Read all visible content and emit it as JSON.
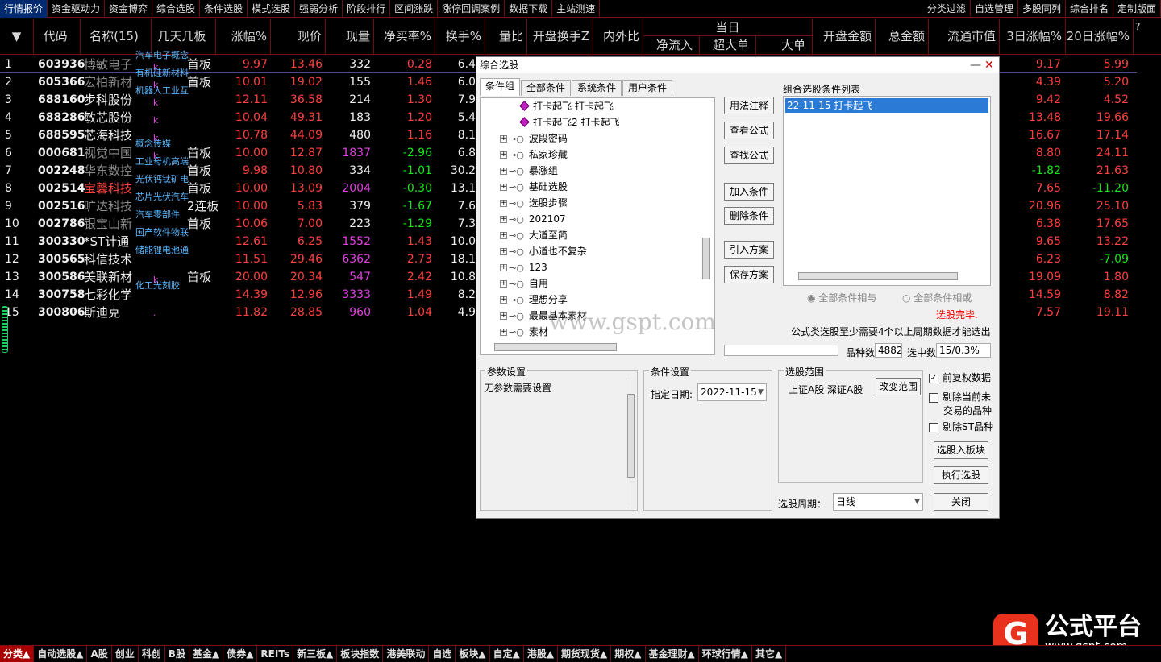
{
  "top_menu": {
    "left": [
      "行情报价",
      "资金驱动力",
      "资金博弈",
      "综合选股",
      "条件选股",
      "模式选股",
      "强弱分析",
      "阶段排行",
      "区间涨跌",
      "涨停回调案例",
      "数据下载",
      "主站测速"
    ],
    "right": [
      "分类过滤",
      "自选管理",
      "多股同列",
      "综合排名",
      "定制版面"
    ]
  },
  "header": {
    "code": "代码",
    "name": "名称(15)",
    "days": "几天几板",
    "pct": "涨幅%",
    "price": "现价",
    "vol": "现量",
    "netbuy": "净买率%",
    "turnover": "换手%",
    "ratio": "量比",
    "open_turnover": "开盘换手Z",
    "inout": "内外比",
    "today": "当日",
    "inflow": "净流入",
    "super": "超大单",
    "big": "大单",
    "open_amount": "开盘金额",
    "total_amount": "总金额",
    "mcap": "流通市值",
    "d3": "3日涨幅%",
    "d20": "20日涨幅%",
    "q": "?"
  },
  "rows": [
    {
      "idx": "1",
      "code": "603936",
      "name": "博敏电子",
      "name_color": "gry",
      "tag": "汽车电子概念",
      "k": "k",
      "days": "首板",
      "pct": "9.97",
      "price": "13.46",
      "vol": "332",
      "vol_color": "wht",
      "netbuy": "0.28",
      "nb_color": "red",
      "turn": "6.4",
      "d3": "9.17",
      "d3c": "red",
      "d20": "5.99",
      "d20c": "red"
    },
    {
      "idx": "2",
      "code": "605366",
      "name": "宏柏新材",
      "name_color": "gry",
      "tag": "有机硅新材料",
      "k": "k",
      "days": "首板",
      "pct": "10.01",
      "price": "19.02",
      "vol": "155",
      "vol_color": "wht",
      "netbuy": "1.46",
      "nb_color": "red",
      "turn": "6.0",
      "d3": "4.39",
      "d3c": "red",
      "d20": "5.20",
      "d20c": "red"
    },
    {
      "idx": "3",
      "code": "688160",
      "name": "步科股份",
      "name_color": "wht",
      "tag": "机器人工业互",
      "k": "k",
      "days": "",
      "pct": "12.11",
      "price": "36.58",
      "vol": "214",
      "vol_color": "wht",
      "netbuy": "1.30",
      "nb_color": "red",
      "turn": "7.9",
      "d3": "9.42",
      "d3c": "red",
      "d20": "4.52",
      "d20c": "red"
    },
    {
      "idx": "4",
      "code": "688286",
      "name": "敏芯股份",
      "name_color": "wht",
      "tag": "",
      "k": "k",
      "days": "",
      "pct": "10.04",
      "price": "49.31",
      "vol": "183",
      "vol_color": "wht",
      "netbuy": "1.20",
      "nb_color": "red",
      "turn": "5.4",
      "d3": "13.48",
      "d3c": "red",
      "d20": "19.66",
      "d20c": "red"
    },
    {
      "idx": "5",
      "code": "688595",
      "name": "芯海科技",
      "name_color": "wht",
      "tag": "",
      "k": "k",
      "days": "",
      "pct": "10.78",
      "price": "44.09",
      "vol": "480",
      "vol_color": "wht",
      "netbuy": "1.16",
      "nb_color": "red",
      "turn": "8.1",
      "d3": "16.67",
      "d3c": "red",
      "d20": "17.14",
      "d20c": "red"
    },
    {
      "idx": "6",
      "code": "000681",
      "name": "视觉中国",
      "name_color": "gry",
      "tag": "概念传媒",
      "k": "k",
      "days": "首板",
      "pct": "10.00",
      "price": "12.87",
      "vol": "1837",
      "vol_color": "mag",
      "netbuy": "-2.96",
      "nb_color": "grn",
      "turn": "6.8",
      "d3": "8.80",
      "d3c": "red",
      "d20": "24.11",
      "d20c": "red"
    },
    {
      "idx": "7",
      "code": "002248",
      "name": "华东数控",
      "name_color": "gry",
      "tag": "工业母机高端",
      "k": "",
      "days": "首板",
      "pct": "9.98",
      "price": "10.80",
      "vol": "334",
      "vol_color": "wht",
      "netbuy": "-1.01",
      "nb_color": "grn",
      "turn": "30.2",
      "d3": "-1.82",
      "d3c": "grn",
      "d20": "21.63",
      "d20c": "red"
    },
    {
      "idx": "8",
      "code": "002514",
      "name": "宝馨科技",
      "name_color": "red",
      "tag": "光伏钙钛矿电",
      "k": "",
      "days": "首板",
      "pct": "10.00",
      "price": "13.09",
      "vol": "2004",
      "vol_color": "mag",
      "netbuy": "-0.30",
      "nb_color": "grn",
      "turn": "13.1",
      "d3": "7.65",
      "d3c": "red",
      "d20": "-11.20",
      "d20c": "grn"
    },
    {
      "idx": "9",
      "code": "002516",
      "name": "旷达科技",
      "name_color": "gry",
      "tag": "芯片光伏汽车",
      "k": "",
      "days": "2连板",
      "pct": "10.00",
      "price": "5.83",
      "vol": "379",
      "vol_color": "wht",
      "netbuy": "-1.67",
      "nb_color": "grn",
      "turn": "7.6",
      "d3": "20.96",
      "d3c": "red",
      "d20": "25.10",
      "d20c": "red"
    },
    {
      "idx": "10",
      "code": "002786",
      "name": "银宝山新",
      "name_color": "gry",
      "tag": "汽车零部件",
      "k": "",
      "days": "首板",
      "pct": "10.06",
      "price": "7.00",
      "vol": "223",
      "vol_color": "wht",
      "netbuy": "-1.29",
      "nb_color": "grn",
      "turn": "7.3",
      "d3": "6.38",
      "d3c": "red",
      "d20": "17.65",
      "d20c": "red"
    },
    {
      "idx": "11",
      "code": "300330",
      "name": "*ST计通",
      "name_color": "wht",
      "tag": "国产软件物联",
      "k": "",
      "days": "",
      "pct": "12.61",
      "price": "6.25",
      "vol": "1552",
      "vol_color": "mag",
      "netbuy": "1.43",
      "nb_color": "red",
      "turn": "10.0",
      "d3": "9.65",
      "d3c": "red",
      "d20": "13.22",
      "d20c": "red"
    },
    {
      "idx": "12",
      "code": "300565",
      "name": "科信技术",
      "name_color": "wht",
      "tag": "储能锂电池通",
      "k": "",
      "days": "",
      "pct": "11.51",
      "price": "29.46",
      "vol": "6362",
      "vol_color": "mag",
      "netbuy": "2.73",
      "nb_color": "red",
      "turn": "18.1",
      "d3": "6.23",
      "d3c": "red",
      "d20": "-7.09",
      "d20c": "grn"
    },
    {
      "idx": "13",
      "code": "300586",
      "name": "美联新材",
      "name_color": "wht",
      "tag": "",
      "k": "k",
      "days": "首板",
      "pct": "20.00",
      "price": "20.34",
      "vol": "547",
      "vol_color": "mag",
      "netbuy": "2.42",
      "nb_color": "red",
      "turn": "10.8",
      "d3": "19.09",
      "d3c": "red",
      "d20": "1.80",
      "d20c": "red"
    },
    {
      "idx": "14",
      "code": "300758",
      "name": "七彩化学",
      "name_color": "wht",
      "tag": "化工光刻胶",
      "k": "",
      "days": "",
      "pct": "14.39",
      "price": "12.96",
      "vol": "3333",
      "vol_color": "mag",
      "netbuy": "1.49",
      "nb_color": "red",
      "turn": "8.2",
      "d3": "14.59",
      "d3c": "red",
      "d20": "8.82",
      "d20c": "red"
    },
    {
      "idx": "15",
      "code": "300806",
      "name": "斯迪克",
      "name_color": "wht",
      "tag": "",
      "k": "·",
      "days": "",
      "pct": "11.82",
      "price": "28.85",
      "vol": "960",
      "vol_color": "mag",
      "netbuy": "1.04",
      "nb_color": "red",
      "turn": "4.9",
      "d3": "7.57",
      "d3c": "red",
      "d20": "19.11",
      "d20c": "red"
    }
  ],
  "dialog": {
    "title": "综合选股",
    "minimize": "—",
    "close": "✕",
    "tabs": [
      "条件组",
      "全部条件",
      "系统条件",
      "用户条件"
    ],
    "tree": [
      {
        "label": "打卡起飞  打卡起飞",
        "type": "leaf"
      },
      {
        "label": "打卡起飞2  打卡起飞",
        "type": "leaf"
      },
      {
        "label": "波段密码",
        "type": "group"
      },
      {
        "label": "私家珍藏",
        "type": "group"
      },
      {
        "label": "暴涨组",
        "type": "group"
      },
      {
        "label": "基础选股",
        "type": "group"
      },
      {
        "label": "选股步骤",
        "type": "group"
      },
      {
        "label": "202107",
        "type": "group"
      },
      {
        "label": "大道至简",
        "type": "group"
      },
      {
        "label": "小道也不复杂",
        "type": "group"
      },
      {
        "label": "123",
        "type": "group"
      },
      {
        "label": "自用",
        "type": "group"
      },
      {
        "label": "理想分享",
        "type": "group"
      },
      {
        "label": "最最基本素材",
        "type": "group"
      },
      {
        "label": "素材",
        "type": "group"
      }
    ],
    "watermark": "www.gspt.com",
    "buttons": {
      "usage": "用法注释",
      "view_formula": "查看公式",
      "find_formula": "查找公式",
      "add": "加入条件",
      "delete": "删除条件",
      "import": "引入方案",
      "save": "保存方案",
      "to_block": "选股入板块",
      "execute": "执行选股",
      "close": "关闭",
      "change_range": "改变范围"
    },
    "combo_list_title": "组合选股条件列表",
    "combo_items": [
      "22-11-15 打卡起飞"
    ],
    "radio_and": "全部条件相与",
    "radio_or": "全部条件相或",
    "status_done": "选股完毕.",
    "note": "公式类选股至少需要4个以上周期数据才能选出",
    "count_label": "品种数",
    "count_value": "4882",
    "selected_label": "选中数",
    "selected_value": "15/0.3%",
    "param_legend": "参数设置",
    "param_text": "无参数需要设置",
    "cond_legend": "条件设置",
    "date_label": "指定日期:",
    "date_value": "2022-11-15",
    "range_legend": "选股范围",
    "range_value": "上证A股 深证A股",
    "period_label": "选股周期：",
    "period_value": "日线",
    "chk_fuquan": "前复权数据",
    "chk_fuquan_checked": "✓",
    "chk_untrade_1": "剔除当前未",
    "chk_untrade_2": "交易的品种",
    "chk_st": "剔除ST品种"
  },
  "bottom_tabs": [
    "分类▲",
    "自动选股▲",
    "A股",
    "创业",
    "科创",
    "B股",
    "基金▲",
    "债券▲",
    "REITs",
    "新三板▲",
    "板块指数",
    "港美联动",
    "自选",
    "板块▲",
    "自定▲",
    "港股▲",
    "期货现货▲",
    "期权▲",
    "基金理财▲",
    "环球行情▲",
    "其它▲"
  ],
  "logo": {
    "glyph": "G",
    "big": "公式平台",
    "small": "www.gspt.com"
  },
  "colors": {
    "accent_red": "#ff4040",
    "up_green": "#19e619",
    "volume_magenta": "#e040e0",
    "tag_blue": "#5ab8ff",
    "logo_red": "#e8321e"
  }
}
